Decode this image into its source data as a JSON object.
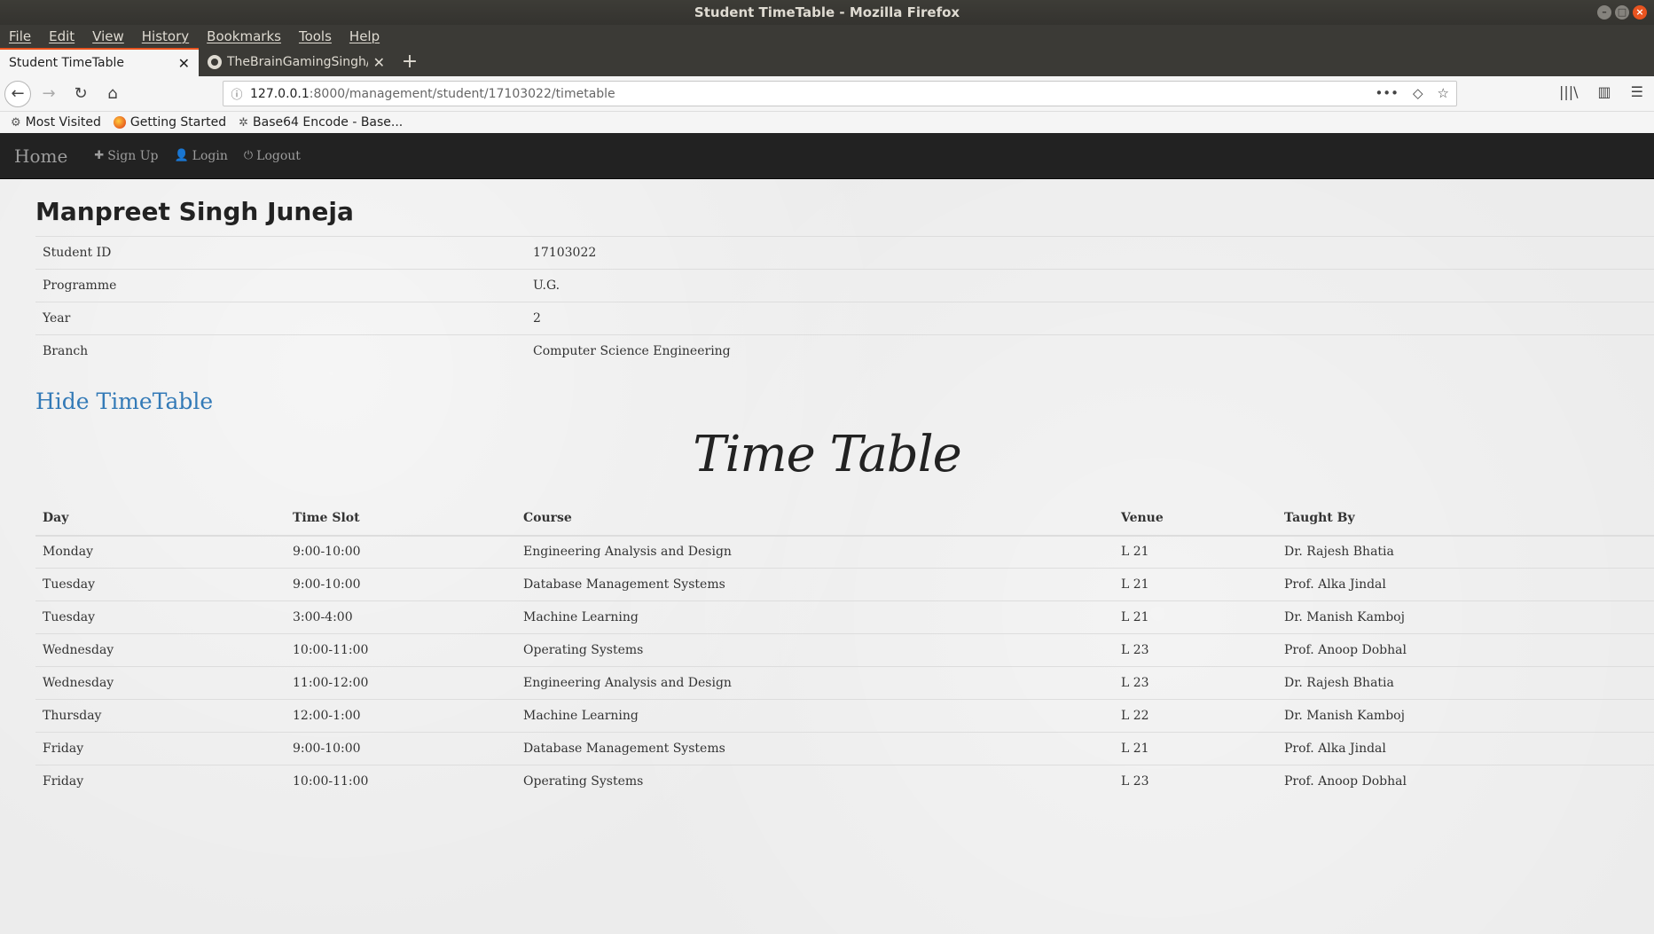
{
  "window": {
    "title": "Student TimeTable - Mozilla Firefox"
  },
  "menu": [
    "File",
    "Edit",
    "View",
    "History",
    "Bookmarks",
    "Tools",
    "Help"
  ],
  "tabs": [
    {
      "label": "Student TimeTable",
      "active": true
    },
    {
      "label": "TheBrainGamingSingh/T",
      "active": false
    }
  ],
  "url": {
    "host": "127.0.0.1",
    "path": ":8000/management/student/17103022/timetable"
  },
  "bookmarks": [
    "Most Visited",
    "Getting Started",
    "Base64 Encode - Base..."
  ],
  "site_nav": {
    "brand": "Home",
    "signup": "Sign Up",
    "login": "Login",
    "logout": "Logout"
  },
  "student": {
    "name": "Manpreet Singh Juneja",
    "info": [
      {
        "key": "Student ID",
        "value": "17103022"
      },
      {
        "key": "Programme",
        "value": "U.G."
      },
      {
        "key": "Year",
        "value": "2"
      },
      {
        "key": "Branch",
        "value": "Computer Science Engineering"
      }
    ]
  },
  "toggle_label": "Hide TimeTable",
  "timetable": {
    "title": "Time Table",
    "headers": [
      "Day",
      "Time Slot",
      "Course",
      "Venue",
      "Taught By"
    ],
    "rows": [
      [
        "Monday",
        "9:00-10:00",
        "Engineering Analysis and Design",
        "L 21",
        "Dr. Rajesh Bhatia"
      ],
      [
        "Tuesday",
        "9:00-10:00",
        "Database Management Systems",
        "L 21",
        "Prof. Alka Jindal"
      ],
      [
        "Tuesday",
        "3:00-4:00",
        "Machine Learning",
        "L 21",
        "Dr. Manish Kamboj"
      ],
      [
        "Wednesday",
        "10:00-11:00",
        "Operating Systems",
        "L 23",
        "Prof. Anoop Dobhal"
      ],
      [
        "Wednesday",
        "11:00-12:00",
        "Engineering Analysis and Design",
        "L 23",
        "Dr. Rajesh Bhatia"
      ],
      [
        "Thursday",
        "12:00-1:00",
        "Machine Learning",
        "L 22",
        "Dr. Manish Kamboj"
      ],
      [
        "Friday",
        "9:00-10:00",
        "Database Management Systems",
        "L 21",
        "Prof. Alka Jindal"
      ],
      [
        "Friday",
        "10:00-11:00",
        "Operating Systems",
        "L 23",
        "Prof. Anoop Dobhal"
      ]
    ]
  }
}
